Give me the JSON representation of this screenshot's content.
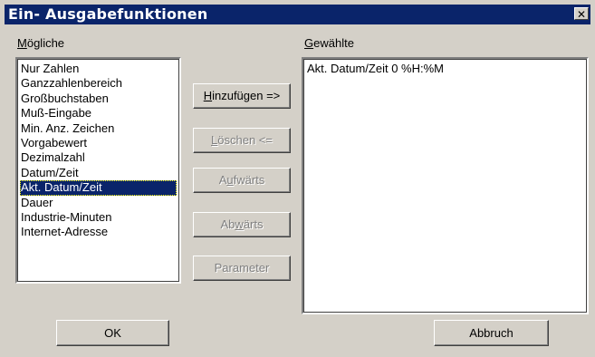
{
  "window": {
    "title": "Ein- Ausgabefunktionen",
    "close_glyph": "✕"
  },
  "available": {
    "label": "Mögliche",
    "items": [
      "Nur Zahlen",
      "Ganzzahlenbereich",
      "Großbuchstaben",
      "Muß-Eingabe",
      "Min. Anz. Zeichen",
      "Vorgabewert",
      "Dezimalzahl",
      "Datum/Zeit",
      "Akt. Datum/Zeit",
      "Dauer",
      "Industrie-Minuten",
      "Internet-Adresse"
    ],
    "selected_index": 8
  },
  "chosen": {
    "label": "Gewählte",
    "items": [
      "Akt. Datum/Zeit  0  %H:%M"
    ]
  },
  "buttons": {
    "add": "Hinzufügen =>",
    "delete": "Löschen <=",
    "up": "Aufwärts",
    "down": "Abwärts",
    "parameter": "Parameter",
    "ok": "OK",
    "cancel": "Abbruch"
  },
  "colors": {
    "face": "#d4d0c8",
    "titlebar": "#0a246a",
    "selection": "#0a246a"
  }
}
